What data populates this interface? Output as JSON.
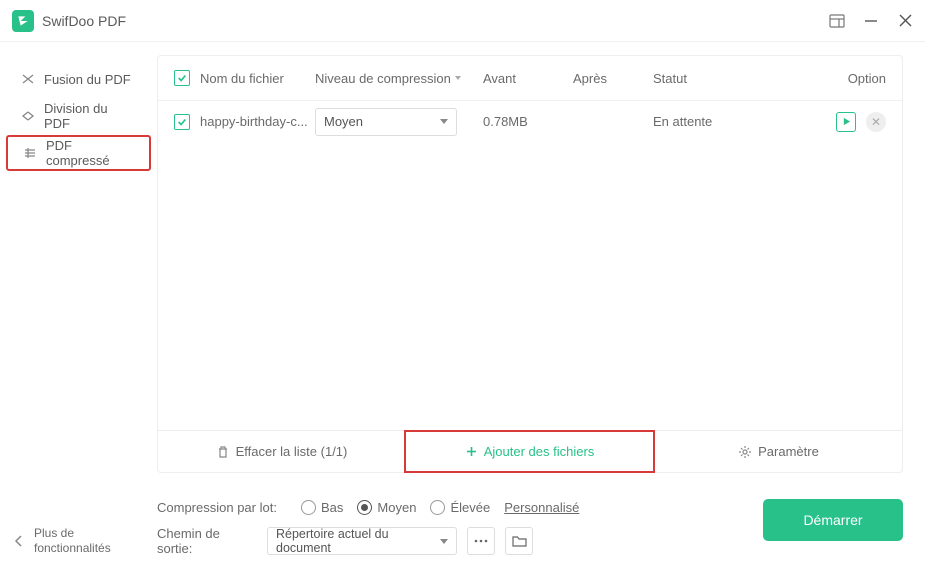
{
  "app": {
    "title": "SwifDoo PDF"
  },
  "sidebar": {
    "items": [
      {
        "label": "Fusion du PDF"
      },
      {
        "label": "Division du PDF"
      },
      {
        "label": "PDF compressé"
      }
    ],
    "more": "Plus de\nfonctionnalités"
  },
  "table": {
    "headers": {
      "name": "Nom du fichier",
      "level": "Niveau de compression",
      "before": "Avant",
      "after": "Après",
      "status": "Statut",
      "option": "Option"
    },
    "rows": [
      {
        "name": "happy-birthday-c...",
        "level": "Moyen",
        "before": "0.78MB",
        "after": "",
        "status": "En attente"
      }
    ],
    "footer": {
      "clear": "Effacer la liste (1/1)",
      "add": "Ajouter des fichiers",
      "settings": "Paramètre"
    }
  },
  "bottom": {
    "batch_label": "Compression par lot:",
    "radio_low": "Bas",
    "radio_mid": "Moyen",
    "radio_high": "Élevée",
    "custom": "Personnalisé",
    "output_label": "Chemin de sortie:",
    "output_value": "Répertoire actuel du document",
    "start": "Démarrer"
  }
}
